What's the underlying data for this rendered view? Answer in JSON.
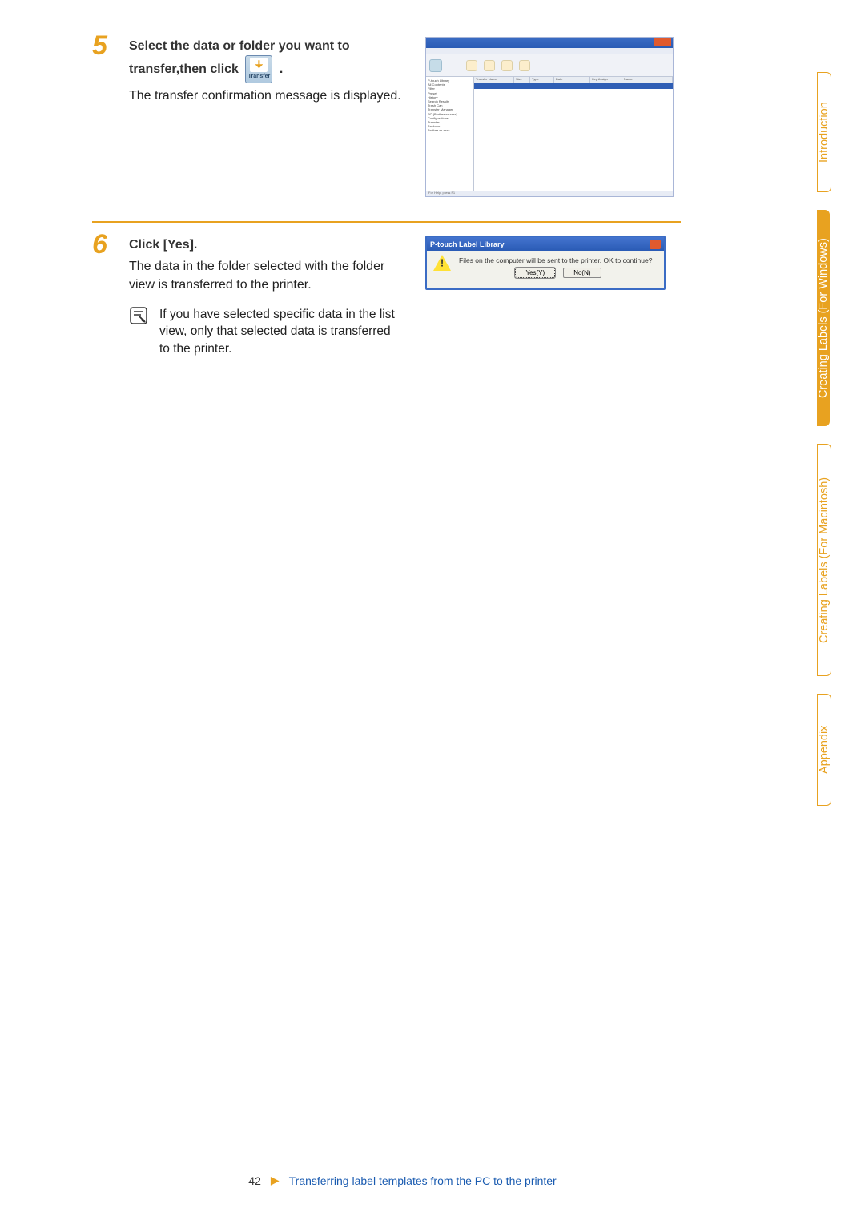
{
  "sideTabs": {
    "introduction": "Introduction",
    "creatingWin": "Creating Labels (For Windows)",
    "creatingMac": "Creating Labels (For Macintosh)",
    "appendix": "Appendix"
  },
  "step5": {
    "number": "5",
    "titlePart1": "Select the data or folder you want to transfer,then click ",
    "titlePart2": ".",
    "desc": "The transfer confirmation message is displayed.",
    "transferIcon": {
      "label": "Transfer"
    },
    "screenshot": {
      "treeItems": [
        "P-touch Library",
        "  All Contents",
        "    Filter",
        "    Preset",
        "    History",
        "  Search Results",
        "  Trash Can",
        "Transfer Manager",
        "  PC (Brother xx-xxxx)",
        "  Configurations",
        "    Transfer",
        "  Backups",
        "  Brother xx-xxxx"
      ],
      "columns": [
        "Transfer Name",
        "Size",
        "Type",
        "Date",
        "Key Assign",
        "Name"
      ],
      "statusText": "For Help, press F1"
    }
  },
  "step6": {
    "number": "6",
    "title": "Click [Yes].",
    "desc": "The data in the folder selected with the folder view is transferred to the printer.",
    "note": "If you have selected specific data in the list view, only that selected data is transferred to the printer.",
    "dialog": {
      "title": "P-touch Label Library",
      "message": "Files on the computer will be sent to the printer. OK to continue?",
      "yesButton": "Yes(Y)",
      "noButton": "No(N)"
    }
  },
  "footer": {
    "pageNumber": "42",
    "arrow": "▶",
    "text": "Transferring label templates from the PC to the printer"
  }
}
